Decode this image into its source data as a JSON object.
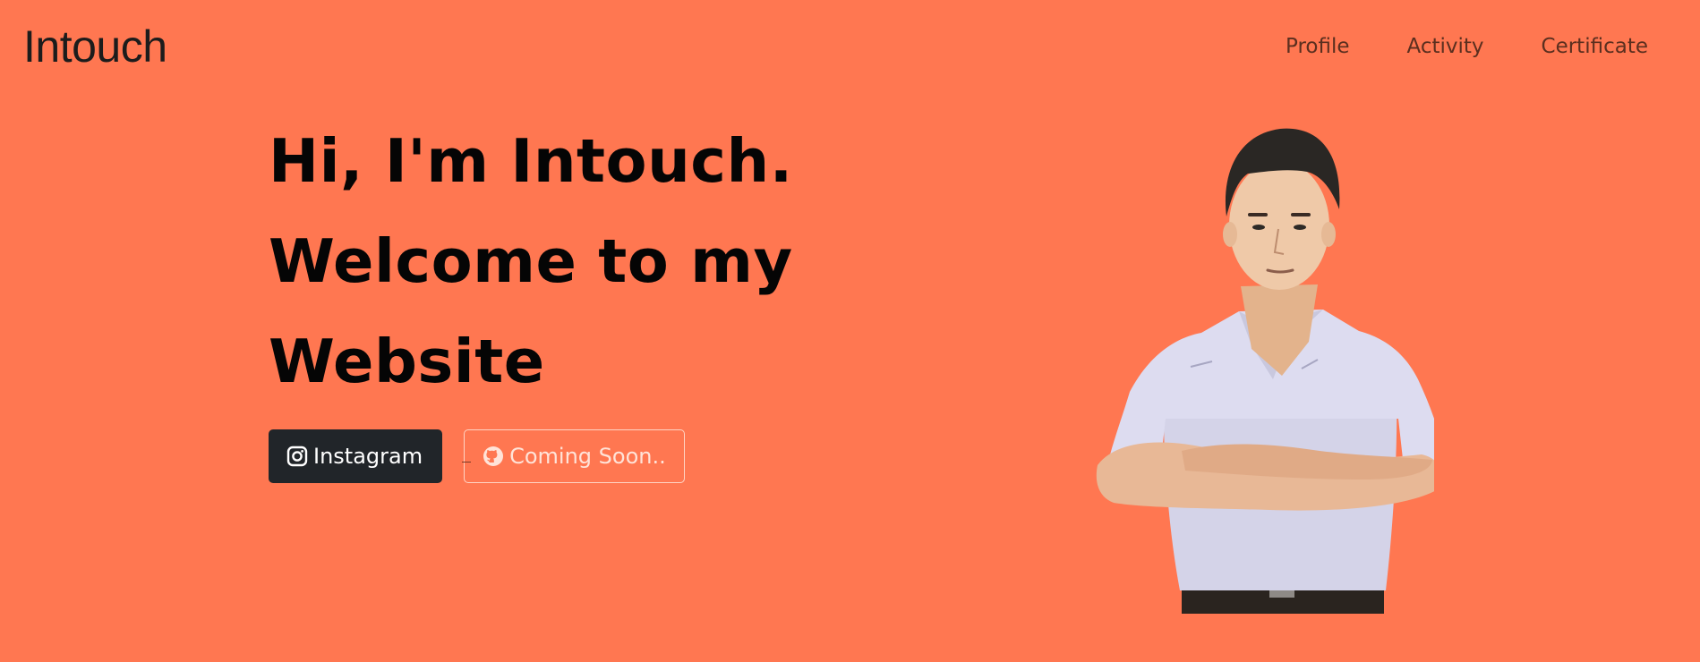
{
  "header": {
    "brand": "Intouch",
    "nav": [
      "Profile",
      "Activity",
      "Certificate"
    ]
  },
  "hero": {
    "title_lines": [
      "Hi, I'm Intouch.",
      "Welcome to my",
      "Website"
    ],
    "instagram_label": "Instagram",
    "github_label": "Coming Soon.."
  },
  "icons": {
    "instagram": "instagram-icon",
    "github": "github-icon"
  },
  "colors": {
    "background": "#ff7751",
    "button_dark": "#212529",
    "outline_text": "#ffe3d8",
    "heading": "#050505"
  }
}
